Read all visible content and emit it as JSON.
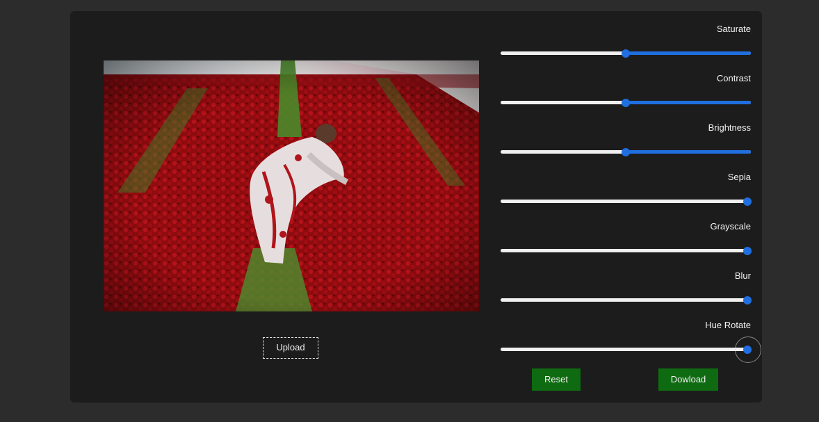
{
  "image": {
    "alt_icon": "photo-preview"
  },
  "upload": {
    "label": "Upload"
  },
  "filters": [
    {
      "label": "Saturate",
      "value": 0.5
    },
    {
      "label": "Contrast",
      "value": 0.5
    },
    {
      "label": "Brightness",
      "value": 0.5
    },
    {
      "label": "Sepia",
      "value": 0.985
    },
    {
      "label": "Grayscale",
      "value": 0.985
    },
    {
      "label": "Blur",
      "value": 0.985
    },
    {
      "label": "Hue Rotate",
      "value": 0.985
    }
  ],
  "actions": {
    "reset_label": "Reset",
    "download_label": "Dowload"
  },
  "colors": {
    "accent": "#1f6fe0",
    "button_bg": "#0f6b12",
    "panel_bg": "#1c1c1c",
    "page_bg": "#2c2c2c"
  }
}
